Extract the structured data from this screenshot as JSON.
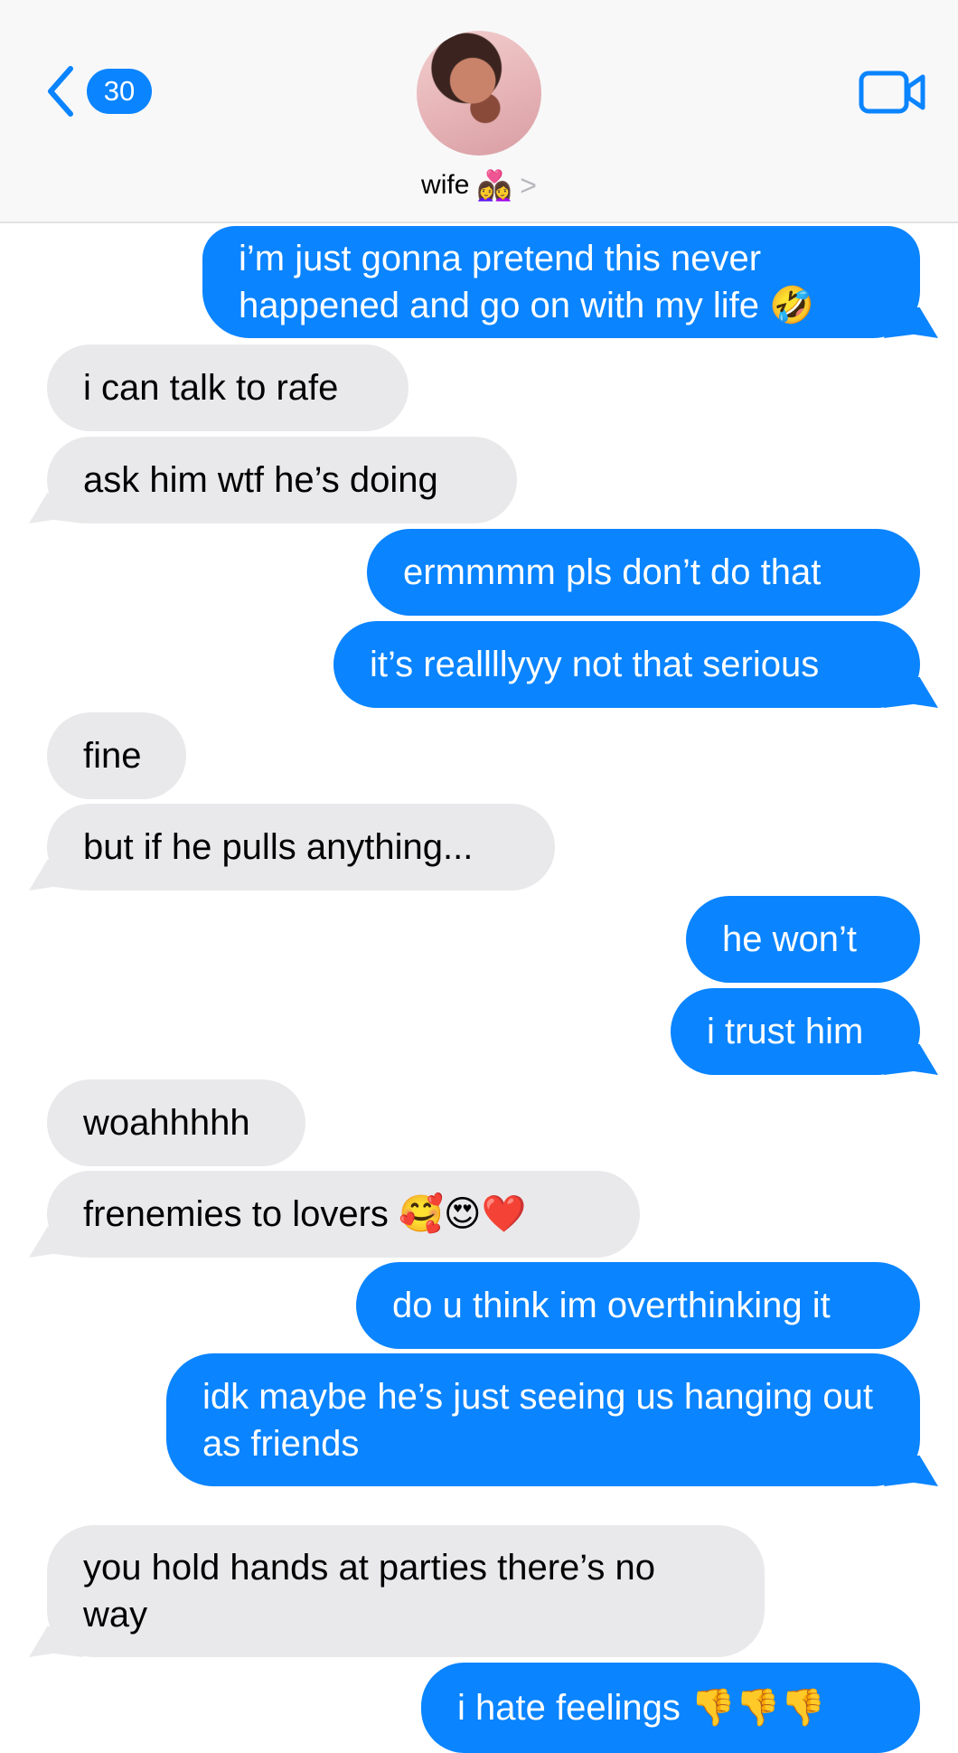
{
  "header": {
    "unread_count": "30",
    "contact_name": "wife",
    "contact_emoji": "👩‍❤️‍👩",
    "contact_chevron": ">",
    "accent_color": "#0a84ff"
  },
  "messages": [
    {
      "sender": "me",
      "text": "i’m just gonna pretend this never happened and go on with my life 🤣"
    },
    {
      "sender": "them",
      "text": "i can talk to rafe"
    },
    {
      "sender": "them",
      "text": "ask him wtf he’s doing"
    },
    {
      "sender": "me",
      "text": "ermmmm pls don’t do that"
    },
    {
      "sender": "me",
      "text": "it’s reallllyyy not that serious"
    },
    {
      "sender": "them",
      "text": "fine"
    },
    {
      "sender": "them",
      "text": "but if he pulls anything..."
    },
    {
      "sender": "me",
      "text": "he won’t"
    },
    {
      "sender": "me",
      "text": "i trust him"
    },
    {
      "sender": "them",
      "text": "woahhhhh"
    },
    {
      "sender": "them",
      "text": "frenemies to lovers 🥰😍❤️"
    },
    {
      "sender": "me",
      "text": "do u think im overthinking it"
    },
    {
      "sender": "me",
      "text": "idk maybe he’s just seeing us hanging out as friends"
    },
    {
      "sender": "them",
      "text": "you hold hands at parties there’s no way"
    },
    {
      "sender": "me",
      "text": "i hate feelings 👎👎👎"
    }
  ],
  "colors": {
    "sent_bubble": "#0a84ff",
    "received_bubble": "#e9e9eb",
    "header_background": "#f8f8f9"
  }
}
